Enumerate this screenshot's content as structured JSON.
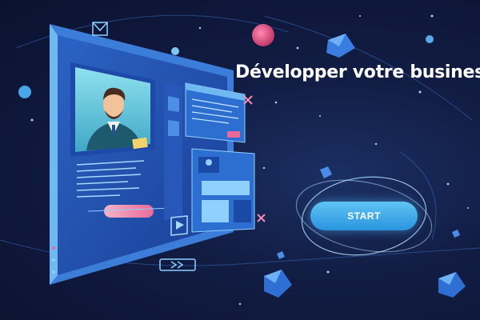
{
  "headline": "Développer votre business",
  "cta": {
    "label": "START"
  },
  "colors": {
    "background": "#121d44",
    "accent": "#2a94e0",
    "accent_light": "#5fc4f3",
    "monitor_frame": "#3b7dd8",
    "highlight_pink": "#e86a9a"
  },
  "icons": [
    "mail-icon",
    "play-icon",
    "forward-icon",
    "close-icon",
    "user-icon"
  ]
}
